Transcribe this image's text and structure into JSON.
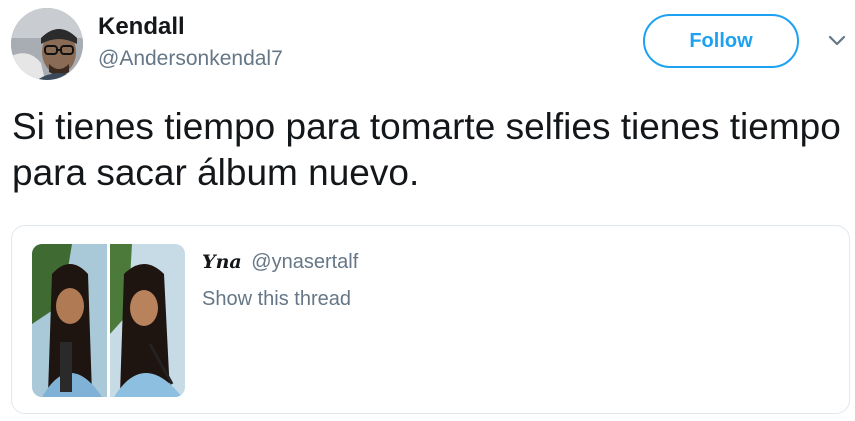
{
  "tweet": {
    "author_name": "Kendall",
    "author_handle": "@Andersonkendal7",
    "text": "Si tienes tiempo para tomarte selfies tienes tiempo para sacar álbum nuevo."
  },
  "actions": {
    "follow_label": "Follow",
    "menu_icon": "chevron-down-icon"
  },
  "quoted_tweet": {
    "author_name": "Yna",
    "author_handle": "@ynasertalf",
    "link_text": "Show this thread"
  },
  "colors": {
    "accent": "#1da1f2",
    "secondary_text": "#657786",
    "border": "#e1e8ed"
  }
}
